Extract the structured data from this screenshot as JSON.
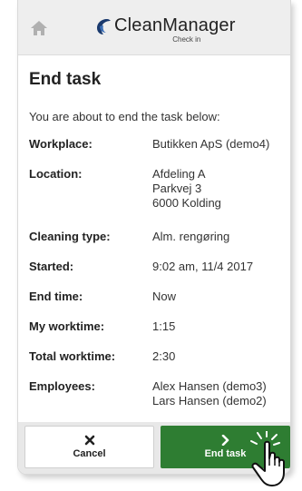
{
  "header": {
    "brand": "CleanManager",
    "subtitle": "Check in"
  },
  "page": {
    "title": "End task",
    "intro": "You are about to end the task below:"
  },
  "details": {
    "workplace_label": "Workplace:",
    "workplace_value": "Butikken ApS (demo4)",
    "location_label": "Location:",
    "location_line1": "Afdeling A",
    "location_line2": "Parkvej 3",
    "location_line3": "6000 Kolding",
    "cleaning_type_label": "Cleaning type:",
    "cleaning_type_value": "Alm. rengøring",
    "started_label": "Started:",
    "started_value": "9:02 am, 11/4 2017",
    "end_time_label": "End time:",
    "end_time_value": "Now",
    "my_worktime_label": "My worktime:",
    "my_worktime_value": "1:15",
    "total_worktime_label": "Total worktime:",
    "total_worktime_value": "2:30",
    "employees_label": "Employees:",
    "employee_1": "Alex Hansen (demo3)",
    "employee_2": "Lars Hansen (demo2)"
  },
  "footer": {
    "cancel_label": "Cancel",
    "end_task_label": "End task"
  },
  "icons": {
    "home": "home-icon",
    "logo": "cleanmanager-logo-icon",
    "cancel": "close-icon",
    "end_task": "chevron-right-icon",
    "pointer": "hand-pointer-icon"
  },
  "colors": {
    "header_bg": "#eeeeee",
    "primary_green": "#2e7d32",
    "text": "#333333"
  }
}
